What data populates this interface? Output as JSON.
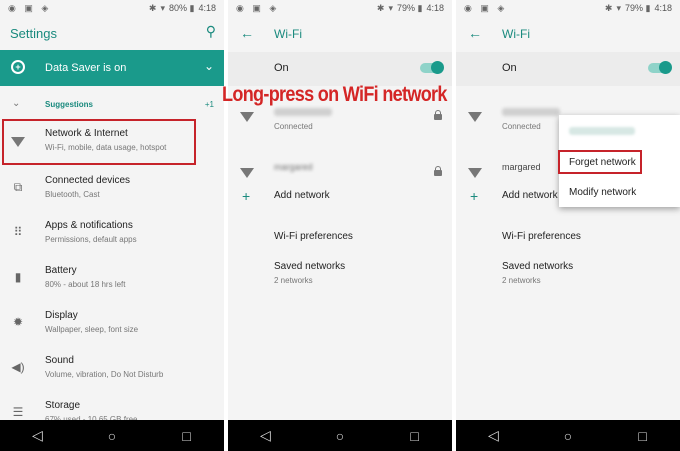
{
  "status": {
    "panel1": {
      "battery": "80%",
      "time": "4:18"
    },
    "panel2": {
      "battery": "79%",
      "time": "4:18"
    },
    "panel3": {
      "battery": "79%",
      "time": "4:18"
    }
  },
  "settings": {
    "title": "Settings",
    "data_saver": "Data Saver is on",
    "suggestions_label": "Suggestions",
    "suggestions_count": "+1",
    "items": [
      {
        "title": "Network & Internet",
        "subtitle": "Wi-Fi, mobile, data usage, hotspot",
        "icon": "wifi-icon"
      },
      {
        "title": "Connected devices",
        "subtitle": "Bluetooth, Cast",
        "icon": "devices-icon"
      },
      {
        "title": "Apps & notifications",
        "subtitle": "Permissions, default apps",
        "icon": "apps-icon"
      },
      {
        "title": "Battery",
        "subtitle": "80% - about 18 hrs left",
        "icon": "battery-icon"
      },
      {
        "title": "Display",
        "subtitle": "Wallpaper, sleep, font size",
        "icon": "display-icon"
      },
      {
        "title": "Sound",
        "subtitle": "Volume, vibration, Do Not Disturb",
        "icon": "sound-icon"
      },
      {
        "title": "Storage",
        "subtitle": "67% used - 10.65 GB free",
        "icon": "storage-icon"
      }
    ]
  },
  "wifi": {
    "title": "Wi-Fi",
    "on_label": "On",
    "connected_status": "Connected",
    "second_network": "margared",
    "add_network": "Add network",
    "preferences": "Wi-Fi preferences",
    "saved_networks": "Saved networks",
    "saved_count": "2 networks"
  },
  "annotation": "Long-press on WiFi network",
  "popup": {
    "forget": "Forget network",
    "modify": "Modify network"
  },
  "colors": {
    "accent": "#1a9a8b",
    "highlight": "#c6232a"
  }
}
